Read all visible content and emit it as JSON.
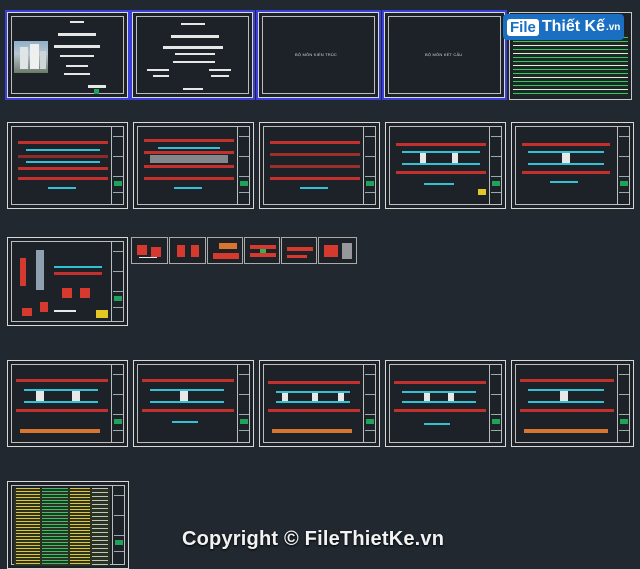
{
  "sheets": {
    "cover_1_title": "",
    "cover_2_title": "",
    "arch_title": "BỘ MÔN KIẾN TRÚC",
    "struct_title": "BỘ MÔN KẾT CẤU"
  },
  "logo": {
    "file": "File",
    "brand": "Thiết Kế",
    "tld": ".vn"
  },
  "watermark": {
    "text": "Copyright © FileThietKe.vn"
  },
  "colors": {
    "background": "#212830",
    "selection": "#3a3fd8",
    "frame": "#d8d8d8",
    "wall_red": "#c4302b",
    "dim_cyan": "#33c1d6",
    "note_yellow": "#e3c825",
    "titleblock_green": "#1fa35a"
  }
}
